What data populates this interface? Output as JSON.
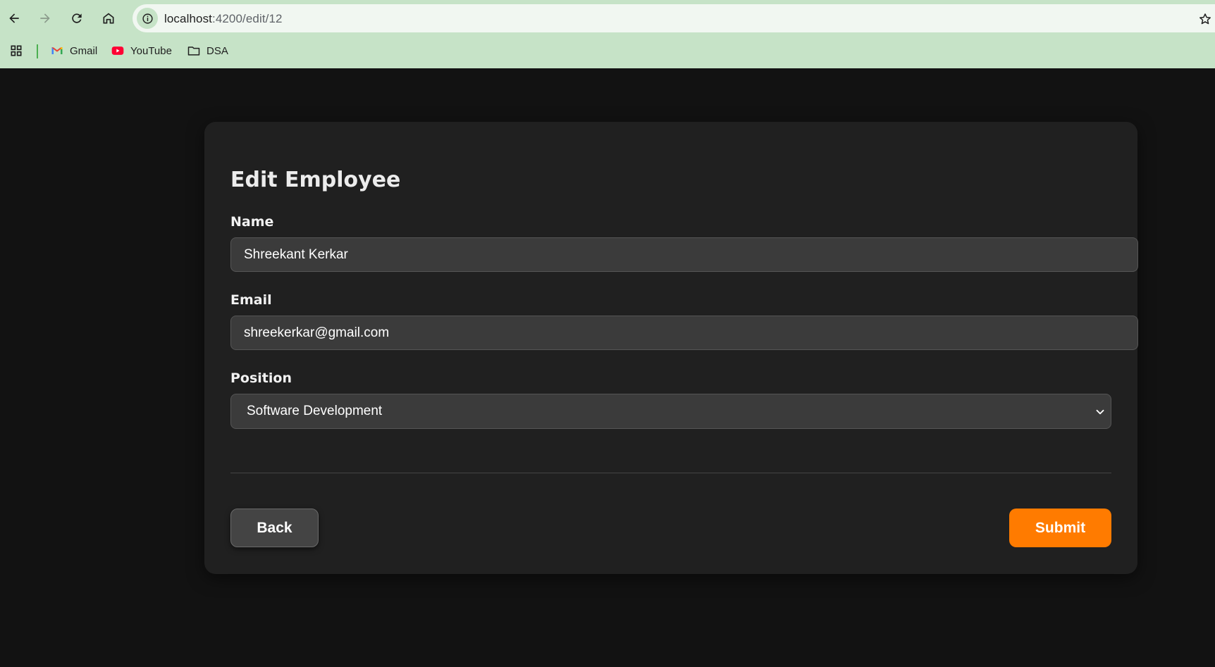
{
  "browser": {
    "url_host": "localhost",
    "url_path": ":4200/edit/12",
    "bookmarks": [
      {
        "label": "Gmail",
        "icon": "gmail-icon"
      },
      {
        "label": "YouTube",
        "icon": "youtube-icon"
      },
      {
        "label": "DSA",
        "icon": "folder-icon"
      }
    ]
  },
  "form": {
    "title": "Edit Employee",
    "name_label": "Name",
    "name_value": "Shreekant Kerkar",
    "email_label": "Email",
    "email_value": "shreekerkar@gmail.com",
    "position_label": "Position",
    "position_value": "Software Development",
    "back_label": "Back",
    "submit_label": "Submit"
  },
  "colors": {
    "accent": "#ff7b00",
    "card_bg": "#202020",
    "page_bg": "#121212",
    "browser_chrome": "#c6e3c7"
  }
}
